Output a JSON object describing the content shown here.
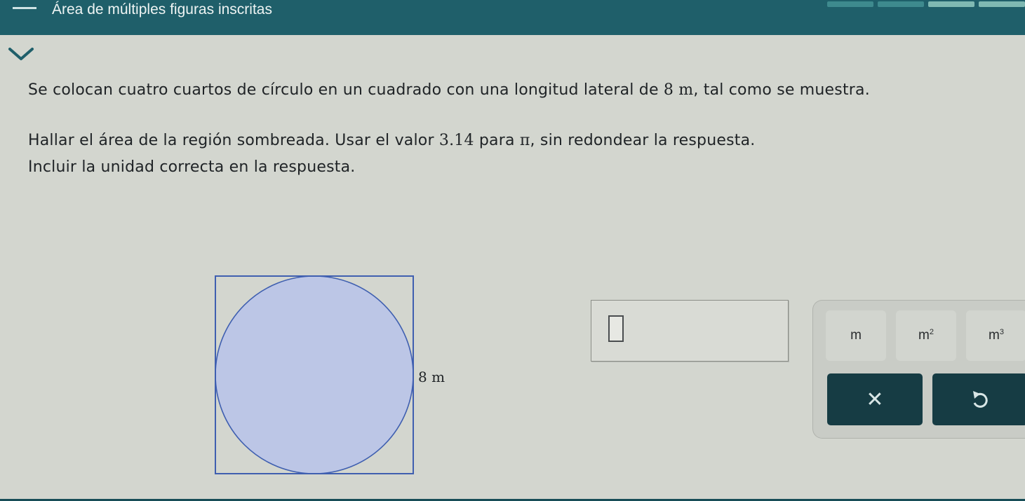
{
  "header": {
    "title": "Área de múltiples figuras inscritas",
    "progress_segments_done": 2,
    "progress_segments_total": 4
  },
  "question": {
    "line1_before": "Se colocan cuatro cuartos de círculo en un cuadrado con una longitud lateral de ",
    "line1_value": "8 m",
    "line1_after": ", tal como se muestra.",
    "line2_before": "Hallar el área de la región sombreada. Usar el valor ",
    "line2_value": "3.14",
    "line2_middle": " para ",
    "line2_pi": "π",
    "line2_after": ", sin redondear la respuesta.",
    "line3": "Incluir la unidad correcta en la respuesta."
  },
  "figure": {
    "side_label": "8 m",
    "shade_color": "#bcc6e6",
    "stroke_color": "#3f5fb0"
  },
  "answer": {
    "value": ""
  },
  "units": {
    "m": "m",
    "m2_base": "m",
    "m2_exp": "2",
    "m3_base": "m",
    "m3_exp": "3"
  },
  "actions": {
    "clear_glyph": "✕",
    "undo_glyph": "undo-icon"
  },
  "colors": {
    "header_bg": "#1f5f6a",
    "action_bg": "#163c44",
    "page_bg": "#d3d6cf"
  }
}
